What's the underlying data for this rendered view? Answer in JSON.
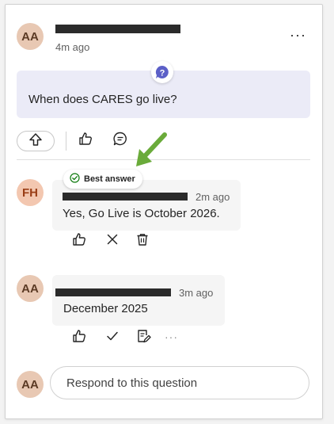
{
  "question": {
    "author_initials": "AA",
    "time": "4m ago",
    "text": "When does CARES go live?",
    "more_label": "···",
    "avatar_bg": "#e8c8b3",
    "avatar_fg": "#5b3a24",
    "icons": [
      "question-icon",
      "upvote-icon",
      "like-icon",
      "comment-icon"
    ]
  },
  "replies": [
    {
      "author_initials": "FH",
      "time": "2m ago",
      "text": "Yes, Go Live is October 2026.",
      "avatar_bg": "#f3c7b0",
      "avatar_fg": "#9a3e16",
      "badge": "Best answer",
      "icons": [
        "like-icon",
        "close-icon",
        "delete-icon"
      ]
    },
    {
      "author_initials": "AA",
      "time": "3m ago",
      "text": "December 2025",
      "avatar_bg": "#e8c8b3",
      "avatar_fg": "#5b3a24",
      "more_label": "···",
      "icons": [
        "like-icon",
        "check-icon",
        "note-icon",
        "more-icon"
      ]
    }
  ],
  "composer": {
    "author_initials": "AA",
    "placeholder": "Respond to this question"
  },
  "colors": {
    "accent": "#5b5fc7",
    "best_answer_green": "#107c10",
    "annotation_arrow": "#6aab3a"
  }
}
